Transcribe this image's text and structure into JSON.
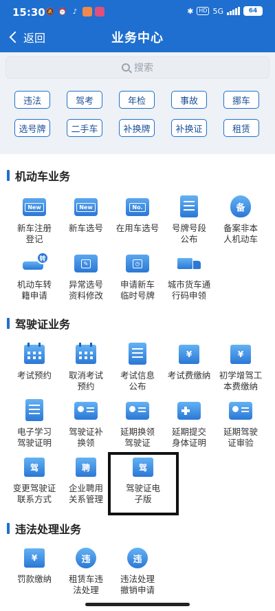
{
  "status_bar": {
    "time": "15:30",
    "hd": "HD",
    "network": "5G",
    "battery": "64"
  },
  "nav": {
    "back_label": "返回",
    "title": "业务中心"
  },
  "search": {
    "placeholder": "搜索"
  },
  "quick_chips": [
    "违法",
    "驾考",
    "年检",
    "事故",
    "挪车",
    "选号牌",
    "二手车",
    "补换牌",
    "补换证",
    "租赁"
  ],
  "sections": [
    {
      "title": "机动车业务",
      "items": [
        {
          "label": "新车注册\n登记",
          "icon": "new-car-register-icon"
        },
        {
          "label": "新车选号",
          "icon": "new-plate-icon"
        },
        {
          "label": "在用车选号",
          "icon": "plate-number-icon"
        },
        {
          "label": "号牌号段\n公布",
          "icon": "plate-segment-icon"
        },
        {
          "label": "备案非本\n人机动车",
          "icon": "record-badge-icon",
          "glyph": "备"
        },
        {
          "label": "机动车转\n籍申请",
          "icon": "transfer-car-icon",
          "glyph": "转"
        },
        {
          "label": "异常选号\n资料修改",
          "icon": "edit-card-icon"
        },
        {
          "label": "申请新车\n临时号牌",
          "icon": "temp-plate-icon"
        },
        {
          "label": "城市货车通\n行码申领",
          "icon": "truck-icon"
        }
      ]
    },
    {
      "title": "驾驶证业务",
      "items": [
        {
          "label": "考试预约",
          "icon": "calendar-icon"
        },
        {
          "label": "取消考试\n预约",
          "icon": "calendar-cancel-icon"
        },
        {
          "label": "考试信息\n公布",
          "icon": "exam-info-icon"
        },
        {
          "label": "考试费缴纳",
          "icon": "exam-fee-icon",
          "glyph": "¥"
        },
        {
          "label": "初学增驾工\n本费缴纳",
          "icon": "fee-card-icon",
          "glyph": "¥"
        },
        {
          "label": "电子学习\n驾驶证明",
          "icon": "study-doc-icon"
        },
        {
          "label": "驾驶证补\n换领",
          "icon": "license-replace-icon"
        },
        {
          "label": "延期换领\n驾驶证",
          "icon": "license-extend-icon"
        },
        {
          "label": "延期提交\n身体证明",
          "icon": "health-cert-icon"
        },
        {
          "label": "延期驾驶\n证审验",
          "icon": "license-review-icon"
        },
        {
          "label": "变更驾驶证\n联系方式",
          "icon": "license-contact-icon",
          "glyph": "驾"
        },
        {
          "label": "企业聘用\n关系管理",
          "icon": "employ-doc-icon",
          "glyph": "聘"
        },
        {
          "label": "驾驶证电\n子版",
          "icon": "e-license-icon",
          "glyph": "驾"
        }
      ]
    },
    {
      "title": "违法处理业务",
      "items": [
        {
          "label": "罚款缴纳",
          "icon": "fine-pay-icon",
          "glyph": "¥"
        },
        {
          "label": "租赁车违\n法处理",
          "icon": "rental-violation-icon",
          "glyph": "违"
        },
        {
          "label": "违法处理\n撤销申请",
          "icon": "violation-revoke-icon",
          "glyph": "违"
        }
      ]
    }
  ],
  "colors": {
    "primary": "#1e6fd0",
    "band": "#eef1f5"
  }
}
